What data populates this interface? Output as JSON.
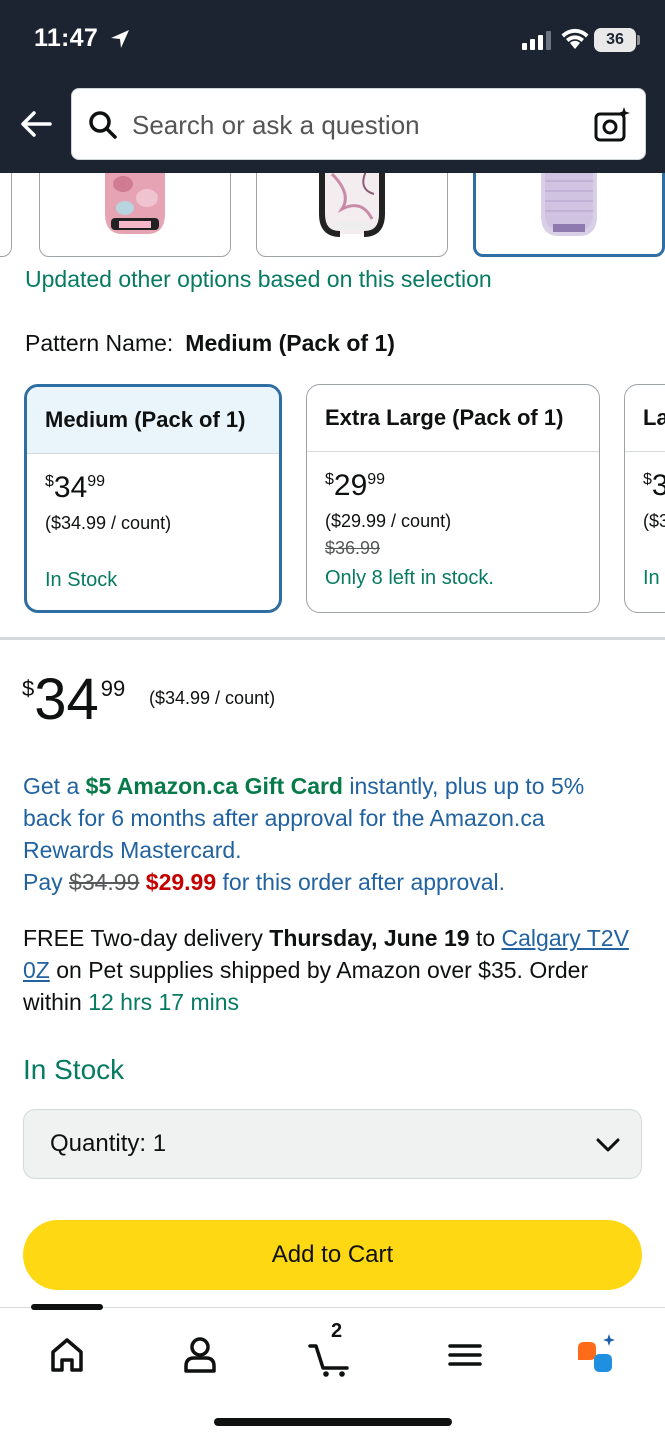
{
  "status_bar": {
    "time": "11:47",
    "battery": "36"
  },
  "header": {
    "search_placeholder": "Search or ask a question",
    "icons": [
      "back-arrow-icon",
      "search-icon",
      "camera-lens-icon"
    ]
  },
  "product_images": {
    "updated_note": "Updated other options based on this selection"
  },
  "pattern": {
    "label": "Pattern Name:",
    "selected": "Medium (Pack of 1)"
  },
  "variants": [
    {
      "title": "Medium (Pack of 1)",
      "price_dollar": "$",
      "price_whole": "34",
      "price_fraction": "99",
      "unit_price": "($34.99 / count)",
      "list_price": "",
      "stock": "In Stock"
    },
    {
      "title": "Extra Large (Pack of 1)",
      "price_dollar": "$",
      "price_whole": "29",
      "price_fraction": "99",
      "unit_price": "($29.99 / count)",
      "list_price": "$36.99",
      "stock": "Only 8 left in stock."
    },
    {
      "title": "La",
      "price_dollar": "$",
      "price_whole": "3",
      "price_fraction": "",
      "unit_price": "($3",
      "list_price": "",
      "stock": "In"
    }
  ],
  "buybox": {
    "currency": "$",
    "price_whole": "34",
    "price_fraction": "99",
    "unit_price": "($34.99 / count)",
    "offer": {
      "prefix": "Get a",
      "highlight": "$5 Amazon.ca Gift Card",
      "text": "instantly, plus up to 5% back for 6 months after approval for the Amazon.ca Rewards Mastercard.",
      "pay_label": "Pay",
      "old_price": "$34.99",
      "new_price": "$29.99",
      "suffix": "for this order after approval."
    },
    "delivery": {
      "prefix": "FREE Two-day delivery",
      "date": "Thursday, June 19",
      "to": "to",
      "location": "Calgary T2V 0Z",
      "mid": "on Pet supplies shipped by Amazon over $35. Order within",
      "countdown": "12 hrs 17 mins"
    },
    "availability": "In Stock",
    "quantity_label": "Quantity:",
    "quantity_value": "1",
    "add_to_cart": "Add to Cart"
  },
  "bottom_nav": {
    "items": [
      "home-icon",
      "account-icon",
      "cart-icon",
      "menu-icon",
      "rufus-assistant-icon"
    ],
    "cart_count": "2"
  },
  "colors": {
    "header_bg": "#1b2430",
    "green_text": "#077a62",
    "link_blue": "#2162a1",
    "sale_red": "#c40000",
    "button_yellow": "#ffd814",
    "selected_border": "#2f6ea2"
  }
}
